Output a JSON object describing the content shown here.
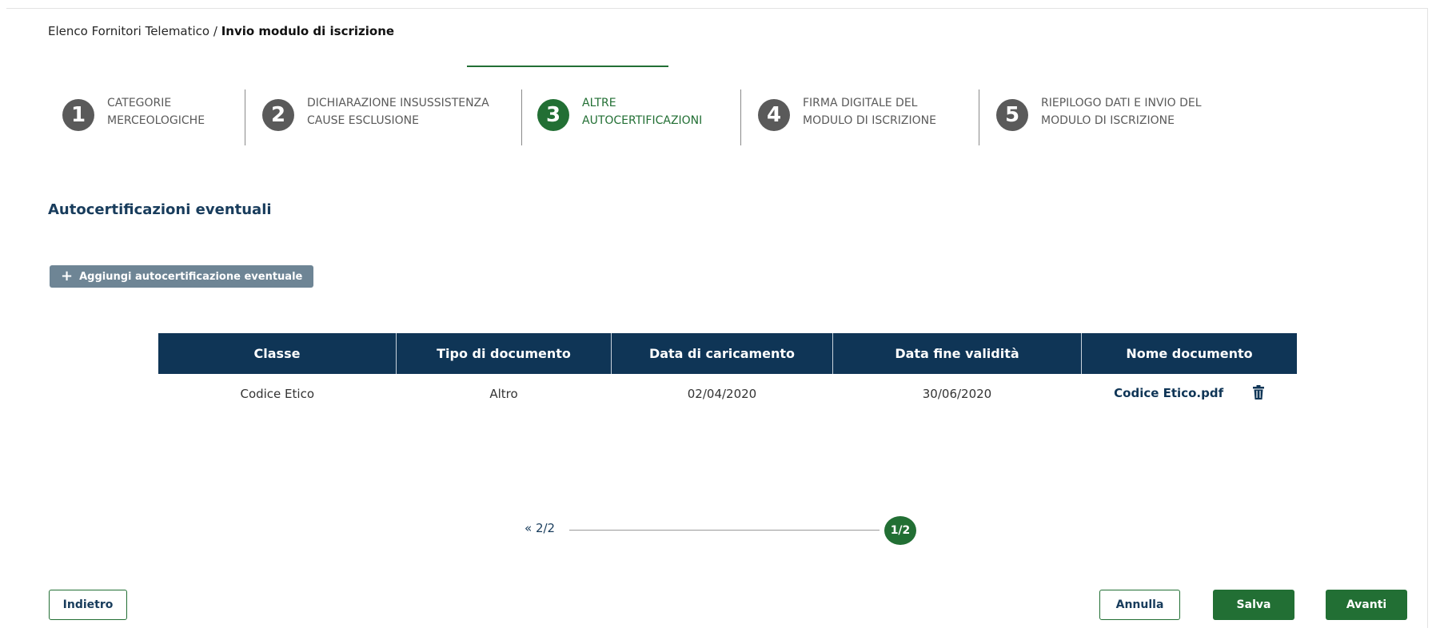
{
  "breadcrumb": {
    "parent": "Elenco Fornitori Telematico /",
    "current": "Invio modulo di iscrizione"
  },
  "steps": [
    {
      "number": "1",
      "line1": "CATEGORIE",
      "line2": "MERCEOLOGICHE"
    },
    {
      "number": "2",
      "line1": "DICHIARAZIONE INSUSSISTENZA",
      "line2": "CAUSE ESCLUSIONE"
    },
    {
      "number": "3",
      "line1": "ALTRE",
      "line2": "AUTOCERTIFICAZIONI"
    },
    {
      "number": "4",
      "line1": "FIRMA DIGITALE DEL",
      "line2": "MODULO DI ISCRIZIONE"
    },
    {
      "number": "5",
      "line1": "RIEPILOGO DATI E INVIO DEL",
      "line2": "MODULO DI ISCRIZIONE"
    }
  ],
  "active_step": "3",
  "section_title": "Autocertificazioni eventuali",
  "add_button": {
    "icon": "plus-icon",
    "label": "Aggiungi autocertificazione eventuale"
  },
  "table": {
    "headers": [
      "Classe",
      "Tipo di documento",
      "Data di caricamento",
      "Data fine validità",
      "Nome documento"
    ],
    "rows": [
      {
        "classe": "Codice Etico",
        "tipo": "Altro",
        "caricamento": "02/04/2020",
        "fine_validita": "30/06/2020",
        "nome": "Codice Etico.pdf",
        "action_icon": "trash-icon"
      }
    ]
  },
  "pagination": {
    "prev_label": "« 2/2",
    "current": "1/2"
  },
  "buttons": {
    "back": "Indietro",
    "cancel": "Annulla",
    "save": "Salva",
    "next": "Avanti"
  },
  "colors": {
    "navy": "#0f3556",
    "green": "#226f34",
    "grey_step": "#5a5a5a",
    "add_button": "#6e8595"
  }
}
